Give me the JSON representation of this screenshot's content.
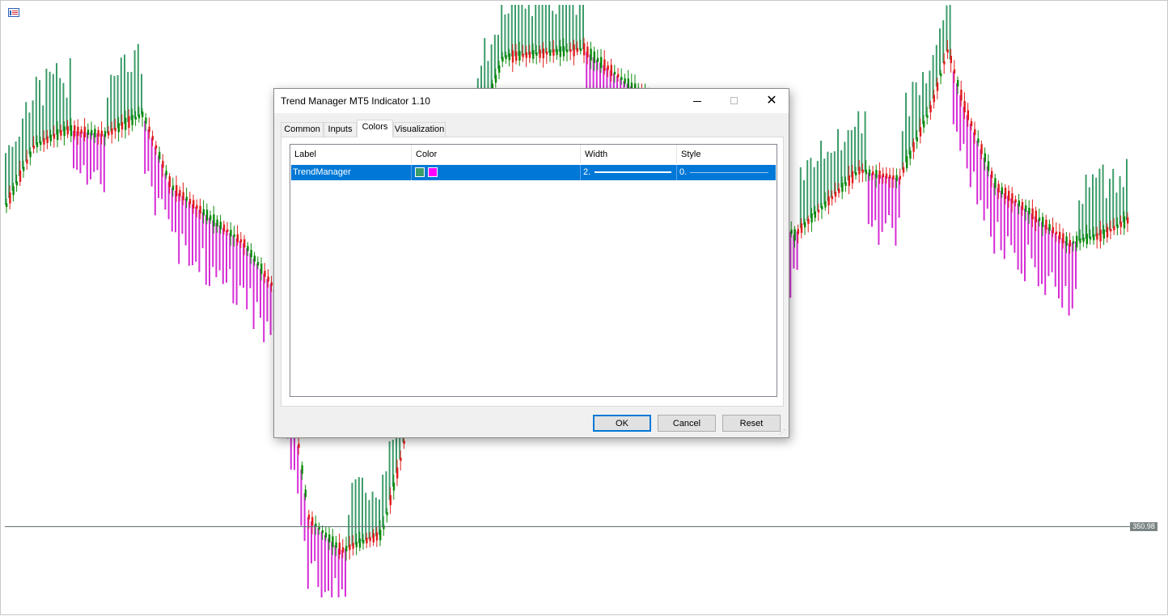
{
  "chart": {
    "price_label": "350.98",
    "colors": {
      "bull_candle": "#0a8a0a",
      "bear_candle": "#e01b1b",
      "trend_up": "#3c9c6a",
      "trend_down": "#d62cd6",
      "price_line": "#5f7073"
    }
  },
  "dialog": {
    "title": "Trend Manager MT5 Indicator 1.10",
    "tabs": [
      "Common",
      "Inputs",
      "Colors",
      "Visualization"
    ],
    "active_tab": "Colors",
    "columns": {
      "label": "Label",
      "color": "Color",
      "width": "Width",
      "style": "Style"
    },
    "rows": [
      {
        "label": "TrendManager",
        "colors": [
          "#3c9c6a",
          "#ff00ff"
        ],
        "width": "2.",
        "style": "0."
      }
    ],
    "buttons": {
      "ok": "OK",
      "cancel": "Cancel",
      "reset": "Reset"
    }
  }
}
